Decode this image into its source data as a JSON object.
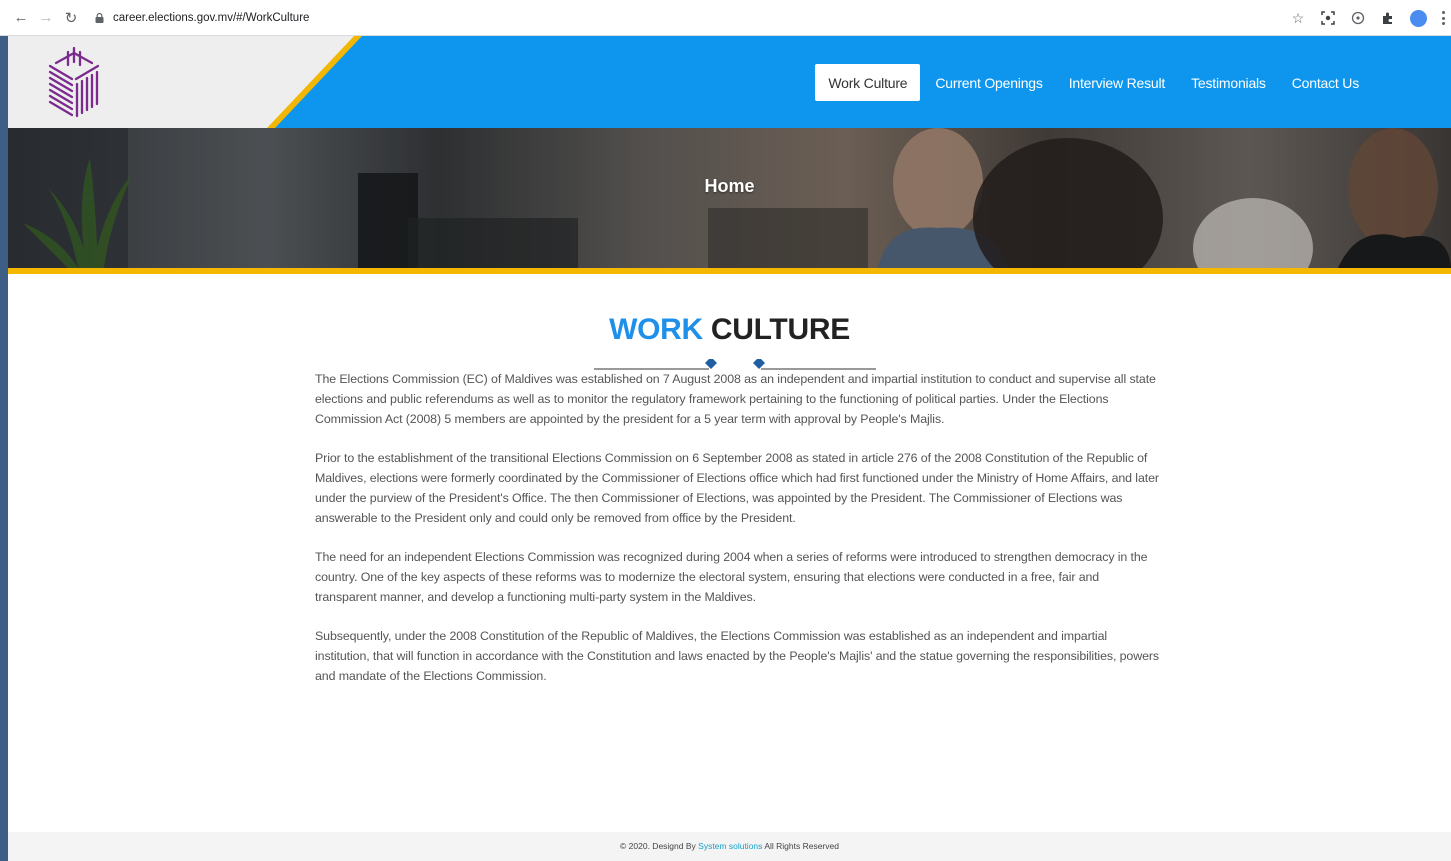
{
  "browser": {
    "url": "career.elections.gov.mv/#/WorkCulture"
  },
  "header": {
    "nav": [
      {
        "label": "Work Culture",
        "active": true
      },
      {
        "label": "Current Openings",
        "active": false
      },
      {
        "label": "Interview Result",
        "active": false
      },
      {
        "label": "Testimonials",
        "active": false
      },
      {
        "label": "Contact Us",
        "active": false
      }
    ]
  },
  "hero": {
    "title": "Home"
  },
  "section": {
    "title_accent": "WORK",
    "title_rest": "CULTURE",
    "paragraphs": [
      "The Elections Commission (EC) of Maldives was established on 7 August 2008 as an independent and impartial institution to conduct and supervise all state elections and public referendums as well as to monitor the regulatory framework pertaining to the functioning of political parties. Under the Elections Commission Act (2008) 5 members are appointed by the president for a 5 year term with approval by People's Majlis.",
      "Prior to the establishment of the transitional Elections Commission on 6 September 2008 as stated in article 276 of the 2008 Constitution of the Republic of Maldives, elections were formerly coordinated by the Commissioner of Elections office which had first functioned under the Ministry of Home Affairs, and later under the purview of the President's Office. The then Commissioner of Elections, was appointed by the President. The Commissioner of Elections was answerable to the President only and could only be removed from office by the President.",
      "The need for an independent Elections Commission was recognized during 2004 when a series of reforms were introduced to strengthen democracy in the country. One of the key aspects of these reforms was to modernize the electoral system, ensuring that elections were conducted in a free, fair and transparent manner, and develop a functioning multi-party system in the Maldives.",
      "Subsequently, under the 2008 Constitution of the Republic of Maldives, the Elections Commission was established as an independent and impartial institution, that will function in accordance with the Constitution and laws enacted by the People's Majlis' and the statue governing the responsibilities, powers and mandate of the Elections Commission."
    ]
  },
  "footer": {
    "prefix": "© 2020. Designd By",
    "link": "System solutions",
    "suffix": "All Rights Reserved"
  },
  "colors": {
    "nav_bar": "#0e96ef",
    "accent": "#1e90ea",
    "hero_border": "#f5b800",
    "logo": "#7b2a8e"
  }
}
